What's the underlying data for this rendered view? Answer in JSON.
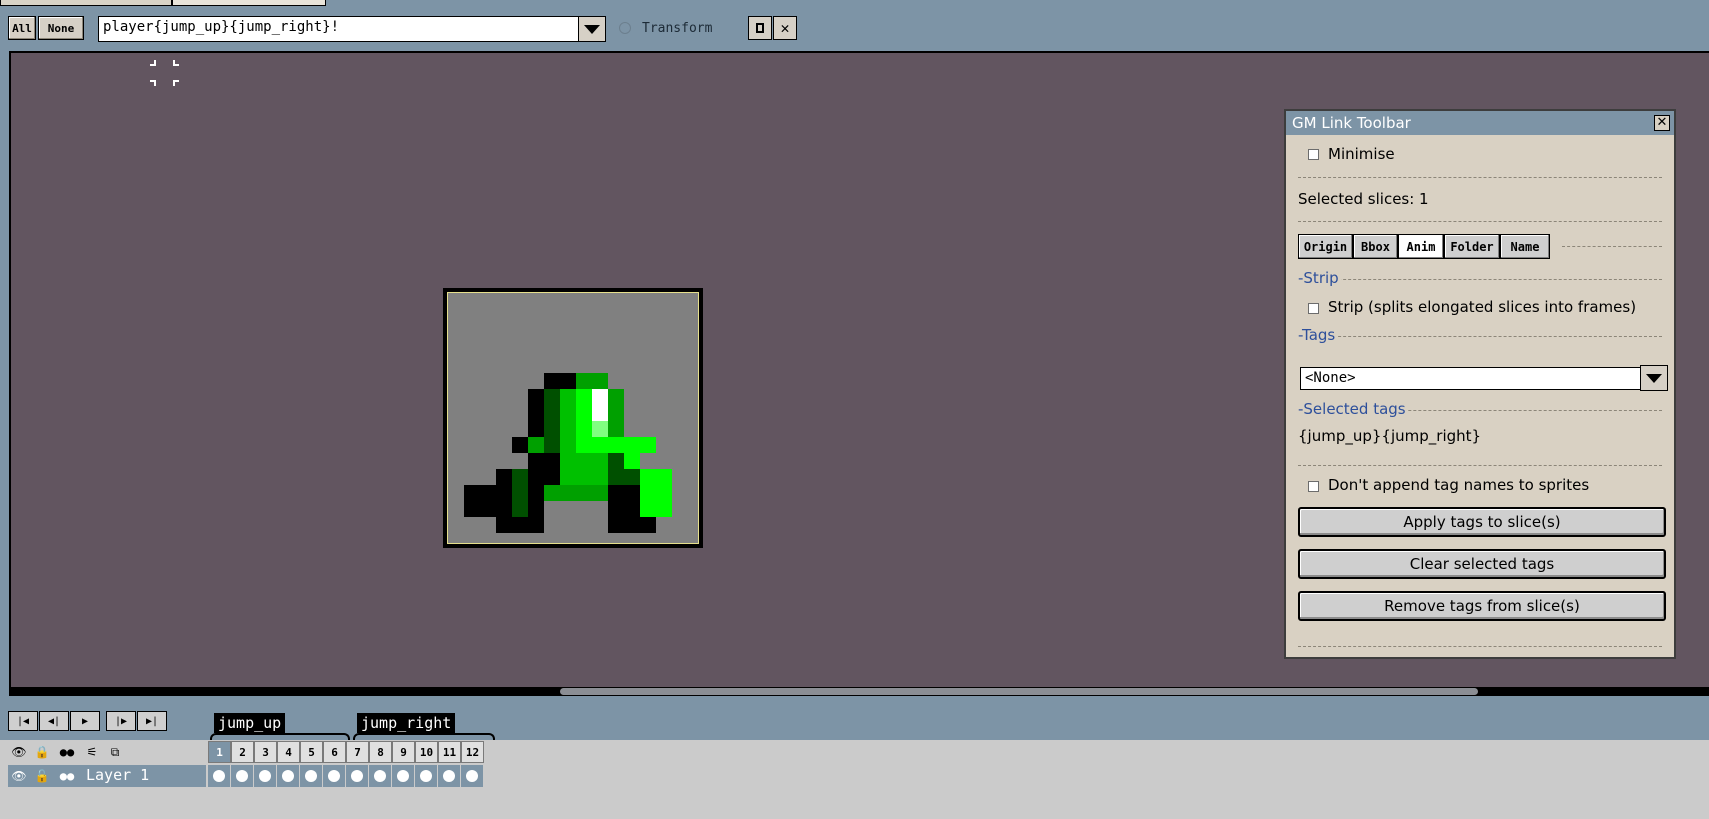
{
  "toolbar": {
    "all_label": "All",
    "none_label": "None",
    "slice_name_value": "player{jump_up}{jump_right}!",
    "transform_label": "Transform",
    "square_btn_icon": "square-icon",
    "close_btn_icon": "close-icon"
  },
  "panel": {
    "title": "GM Link Toolbar",
    "minimise_label": "Minimise",
    "selected_slices": "Selected slices: 1",
    "tabs": [
      "Origin",
      "Bbox",
      "Anim",
      "Folder",
      "Name"
    ],
    "active_tab": "Anim",
    "strip_section": "-Strip",
    "strip_label": "Strip (splits elongated slices into frames)",
    "tags_section": "-Tags",
    "tags_value": "<None>",
    "selected_tags_section": "-Selected tags",
    "selected_tags_value": "{jump_up}{jump_right}",
    "dont_append_label": "Don't append tag names to sprites",
    "apply_btn": "Apply tags to slice(s)",
    "clear_btn": "Clear selected tags",
    "remove_btn": "Remove tags from slice(s)"
  },
  "timeline": {
    "tags": [
      "jump_up",
      "jump_right"
    ],
    "layer_name": "Layer 1",
    "frames": [
      "1",
      "2",
      "3",
      "4",
      "5",
      "6",
      "7",
      "8",
      "9",
      "10",
      "11",
      "12"
    ],
    "active_frame": "1"
  },
  "colors": {
    "canvas_bg": "#625560",
    "ui_blue": "#7d94a6",
    "panel_bg": "#d9d1c3",
    "section_blue": "#2d4f9b",
    "sprite_bright": "#00ff00",
    "sprite_mid": "#00c000",
    "sprite_dark": "#008000",
    "sprite_darker": "#004000"
  }
}
